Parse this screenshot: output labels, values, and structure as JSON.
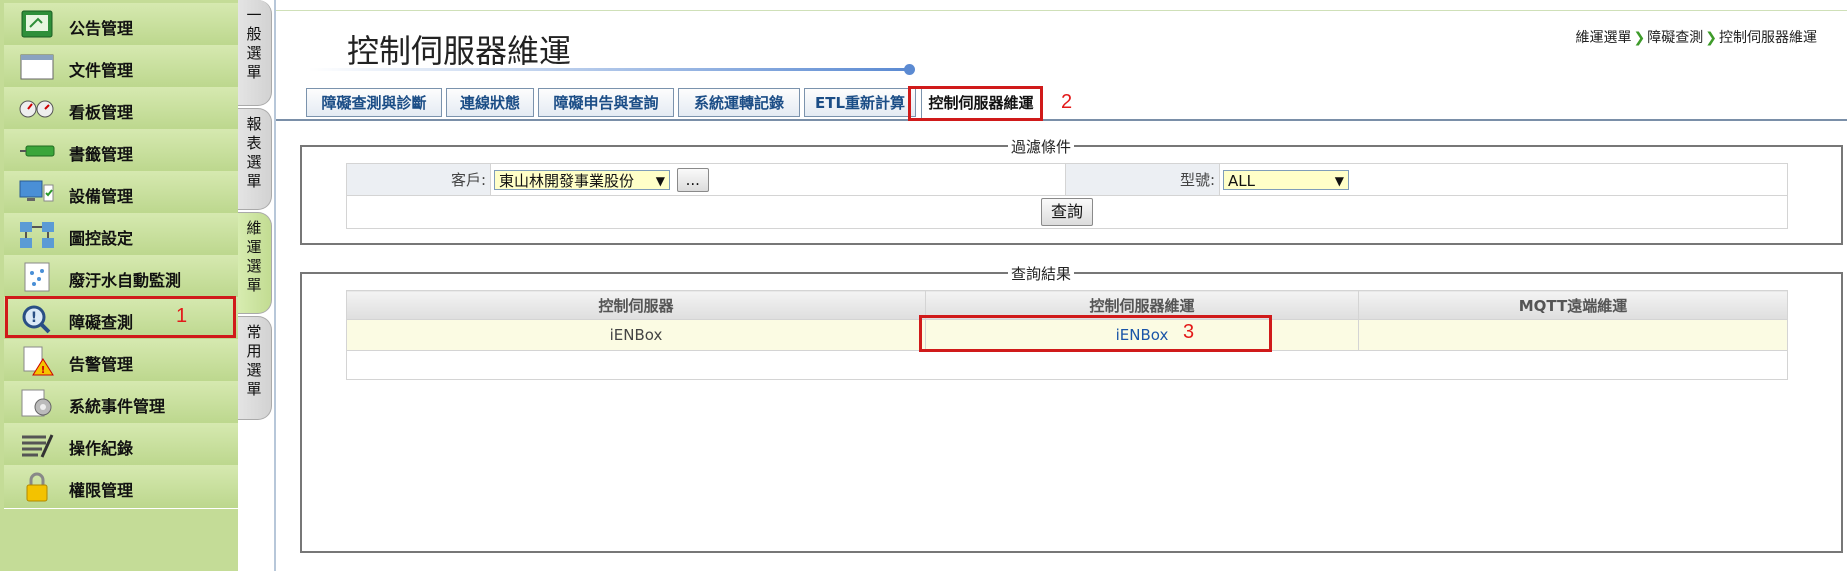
{
  "left_menu": {
    "items": [
      {
        "label": "公告管理",
        "icon": "bulletin-icon"
      },
      {
        "label": "文件管理",
        "icon": "document-icon"
      },
      {
        "label": "看板管理",
        "icon": "dashboard-gauge-icon"
      },
      {
        "label": "書籤管理",
        "icon": "bookmark-icon"
      },
      {
        "label": "設備管理",
        "icon": "equipment-icon"
      },
      {
        "label": "圖控設定",
        "icon": "diagram-icon"
      },
      {
        "label": "廢汙水自動監測",
        "icon": "wastewater-monitor-icon"
      },
      {
        "label": "障礙查測",
        "icon": "fault-search-icon"
      },
      {
        "label": "告警管理",
        "icon": "alert-icon"
      },
      {
        "label": "系統事件管理",
        "icon": "system-event-icon"
      },
      {
        "label": "操作紀錄",
        "icon": "operation-log-icon"
      },
      {
        "label": "權限管理",
        "icon": "lock-icon"
      }
    ],
    "annotation": "1"
  },
  "vertical_tabs": [
    {
      "label": "一般選單"
    },
    {
      "label": "報表選單"
    },
    {
      "label": "維運選單"
    },
    {
      "label": "常用選單"
    }
  ],
  "page": {
    "title": "控制伺服器維運",
    "breadcrumb": [
      "維運選單",
      "障礙查測",
      "控制伺服器維運"
    ]
  },
  "tabs": [
    {
      "label": "障礙查測與診斷"
    },
    {
      "label": "連線狀態"
    },
    {
      "label": "障礙申告與查詢"
    },
    {
      "label": "系統運轉記錄"
    },
    {
      "label": "ETL重新計算"
    },
    {
      "label": "控制伺服器維運"
    }
  ],
  "tab_annotation": "2",
  "filter": {
    "legend": "過濾條件",
    "customer_label": "客戶:",
    "customer_value": "東山林開發事業股份",
    "browse_button": "...",
    "model_label": "型號:",
    "model_value": "ALL",
    "query_button": "查詢"
  },
  "results": {
    "legend": "查詢結果",
    "columns": [
      "控制伺服器",
      "控制伺服器維運",
      "MQTT遠端維運"
    ],
    "rows": [
      {
        "server": "iENBox",
        "maintenance_link": "iENBox",
        "mqtt": ""
      }
    ],
    "annotation": "3"
  },
  "colors": {
    "highlight": "#d01a1a",
    "menu_green": "#c4dc97",
    "link_blue": "#1a55a8"
  }
}
